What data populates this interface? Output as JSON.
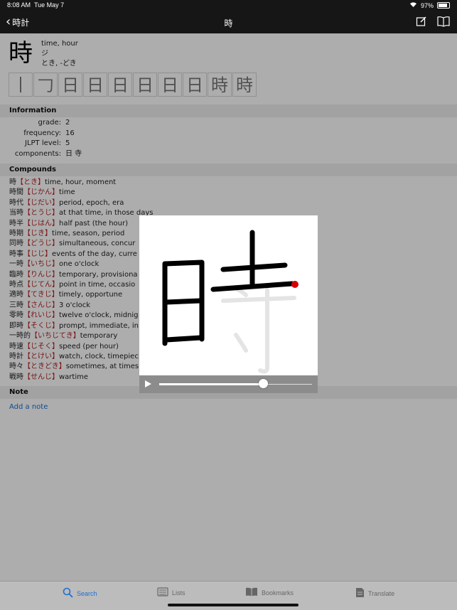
{
  "status": {
    "time": "8:08 AM",
    "date": "Tue May 7",
    "battery": "97%"
  },
  "nav": {
    "back_label": "時計",
    "title": "時"
  },
  "kanji": {
    "character": "時",
    "meanings": [
      "time, hour",
      "ジ",
      "とき, -どき"
    ],
    "stroke_steps": [
      "丨",
      "𠃌",
      "日",
      "日",
      "日",
      "日",
      "日",
      "日",
      "時",
      "時"
    ]
  },
  "information": {
    "header": "Information",
    "rows": [
      {
        "label": "grade:",
        "value": "2"
      },
      {
        "label": "frequency:",
        "value": "16"
      },
      {
        "label": "JLPT level:",
        "value": "5"
      },
      {
        "label": "components:",
        "value": "日 寺"
      }
    ]
  },
  "compounds": {
    "header": "Compounds",
    "rows": [
      {
        "word": "時",
        "reading": "【とき】",
        "meaning": "time, hour, moment"
      },
      {
        "word": "時間",
        "reading": "【じかん】",
        "meaning": "time"
      },
      {
        "word": "時代",
        "reading": "【じだい】",
        "meaning": "period, epoch, era"
      },
      {
        "word": "当時",
        "reading": "【とうじ】",
        "meaning": "at that time, in those days"
      },
      {
        "word": "時半",
        "reading": "【じはん】",
        "meaning": "half past (the hour)"
      },
      {
        "word": "時期",
        "reading": "【じき】",
        "meaning": "time, season, period"
      },
      {
        "word": "同時",
        "reading": "【どうじ】",
        "meaning": "simultaneous, concur"
      },
      {
        "word": "時事",
        "reading": "【じじ】",
        "meaning": "events of the day, curre"
      },
      {
        "word": "一時",
        "reading": "【いちじ】",
        "meaning": "one o'clock"
      },
      {
        "word": "臨時",
        "reading": "【りんじ】",
        "meaning": "temporary, provisiona"
      },
      {
        "word": "時点",
        "reading": "【じてん】",
        "meaning": "point in time, occasio"
      },
      {
        "word": "適時",
        "reading": "【てきじ】",
        "meaning": "timely, opportune"
      },
      {
        "word": "三時",
        "reading": "【さんじ】",
        "meaning": "3 o'clock"
      },
      {
        "word": "零時",
        "reading": "【れいじ】",
        "meaning": "twelve o'clock, midnig"
      },
      {
        "word": "即時",
        "reading": "【そくじ】",
        "meaning": "prompt, immediate, in"
      },
      {
        "word": "一時的",
        "reading": "【いちじてき】",
        "meaning": "temporary"
      },
      {
        "word": "時速",
        "reading": "【じそく】",
        "meaning": "speed (per hour)"
      },
      {
        "word": "時計",
        "reading": "【とけい】",
        "meaning": "watch, clock, timepiec"
      },
      {
        "word": "時々",
        "reading": "【ときどき】",
        "meaning": "sometimes, at times"
      },
      {
        "word": "戦時",
        "reading": "【せんじ】",
        "meaning": "wartime"
      }
    ]
  },
  "note": {
    "header": "Note",
    "add_label": "Add a note"
  },
  "player": {
    "progress": 0.68
  },
  "tabs": [
    {
      "label": "Search",
      "icon": "search-icon",
      "active": true
    },
    {
      "label": "Lists",
      "icon": "lists-icon",
      "active": false
    },
    {
      "label": "Bookmarks",
      "icon": "bookmarks-icon",
      "active": false
    },
    {
      "label": "Translate",
      "icon": "translate-icon",
      "active": false
    }
  ],
  "colors": {
    "accent": "#1f6fd0",
    "reading": "#b51e1e",
    "stroke_highlight": "#d40000"
  }
}
